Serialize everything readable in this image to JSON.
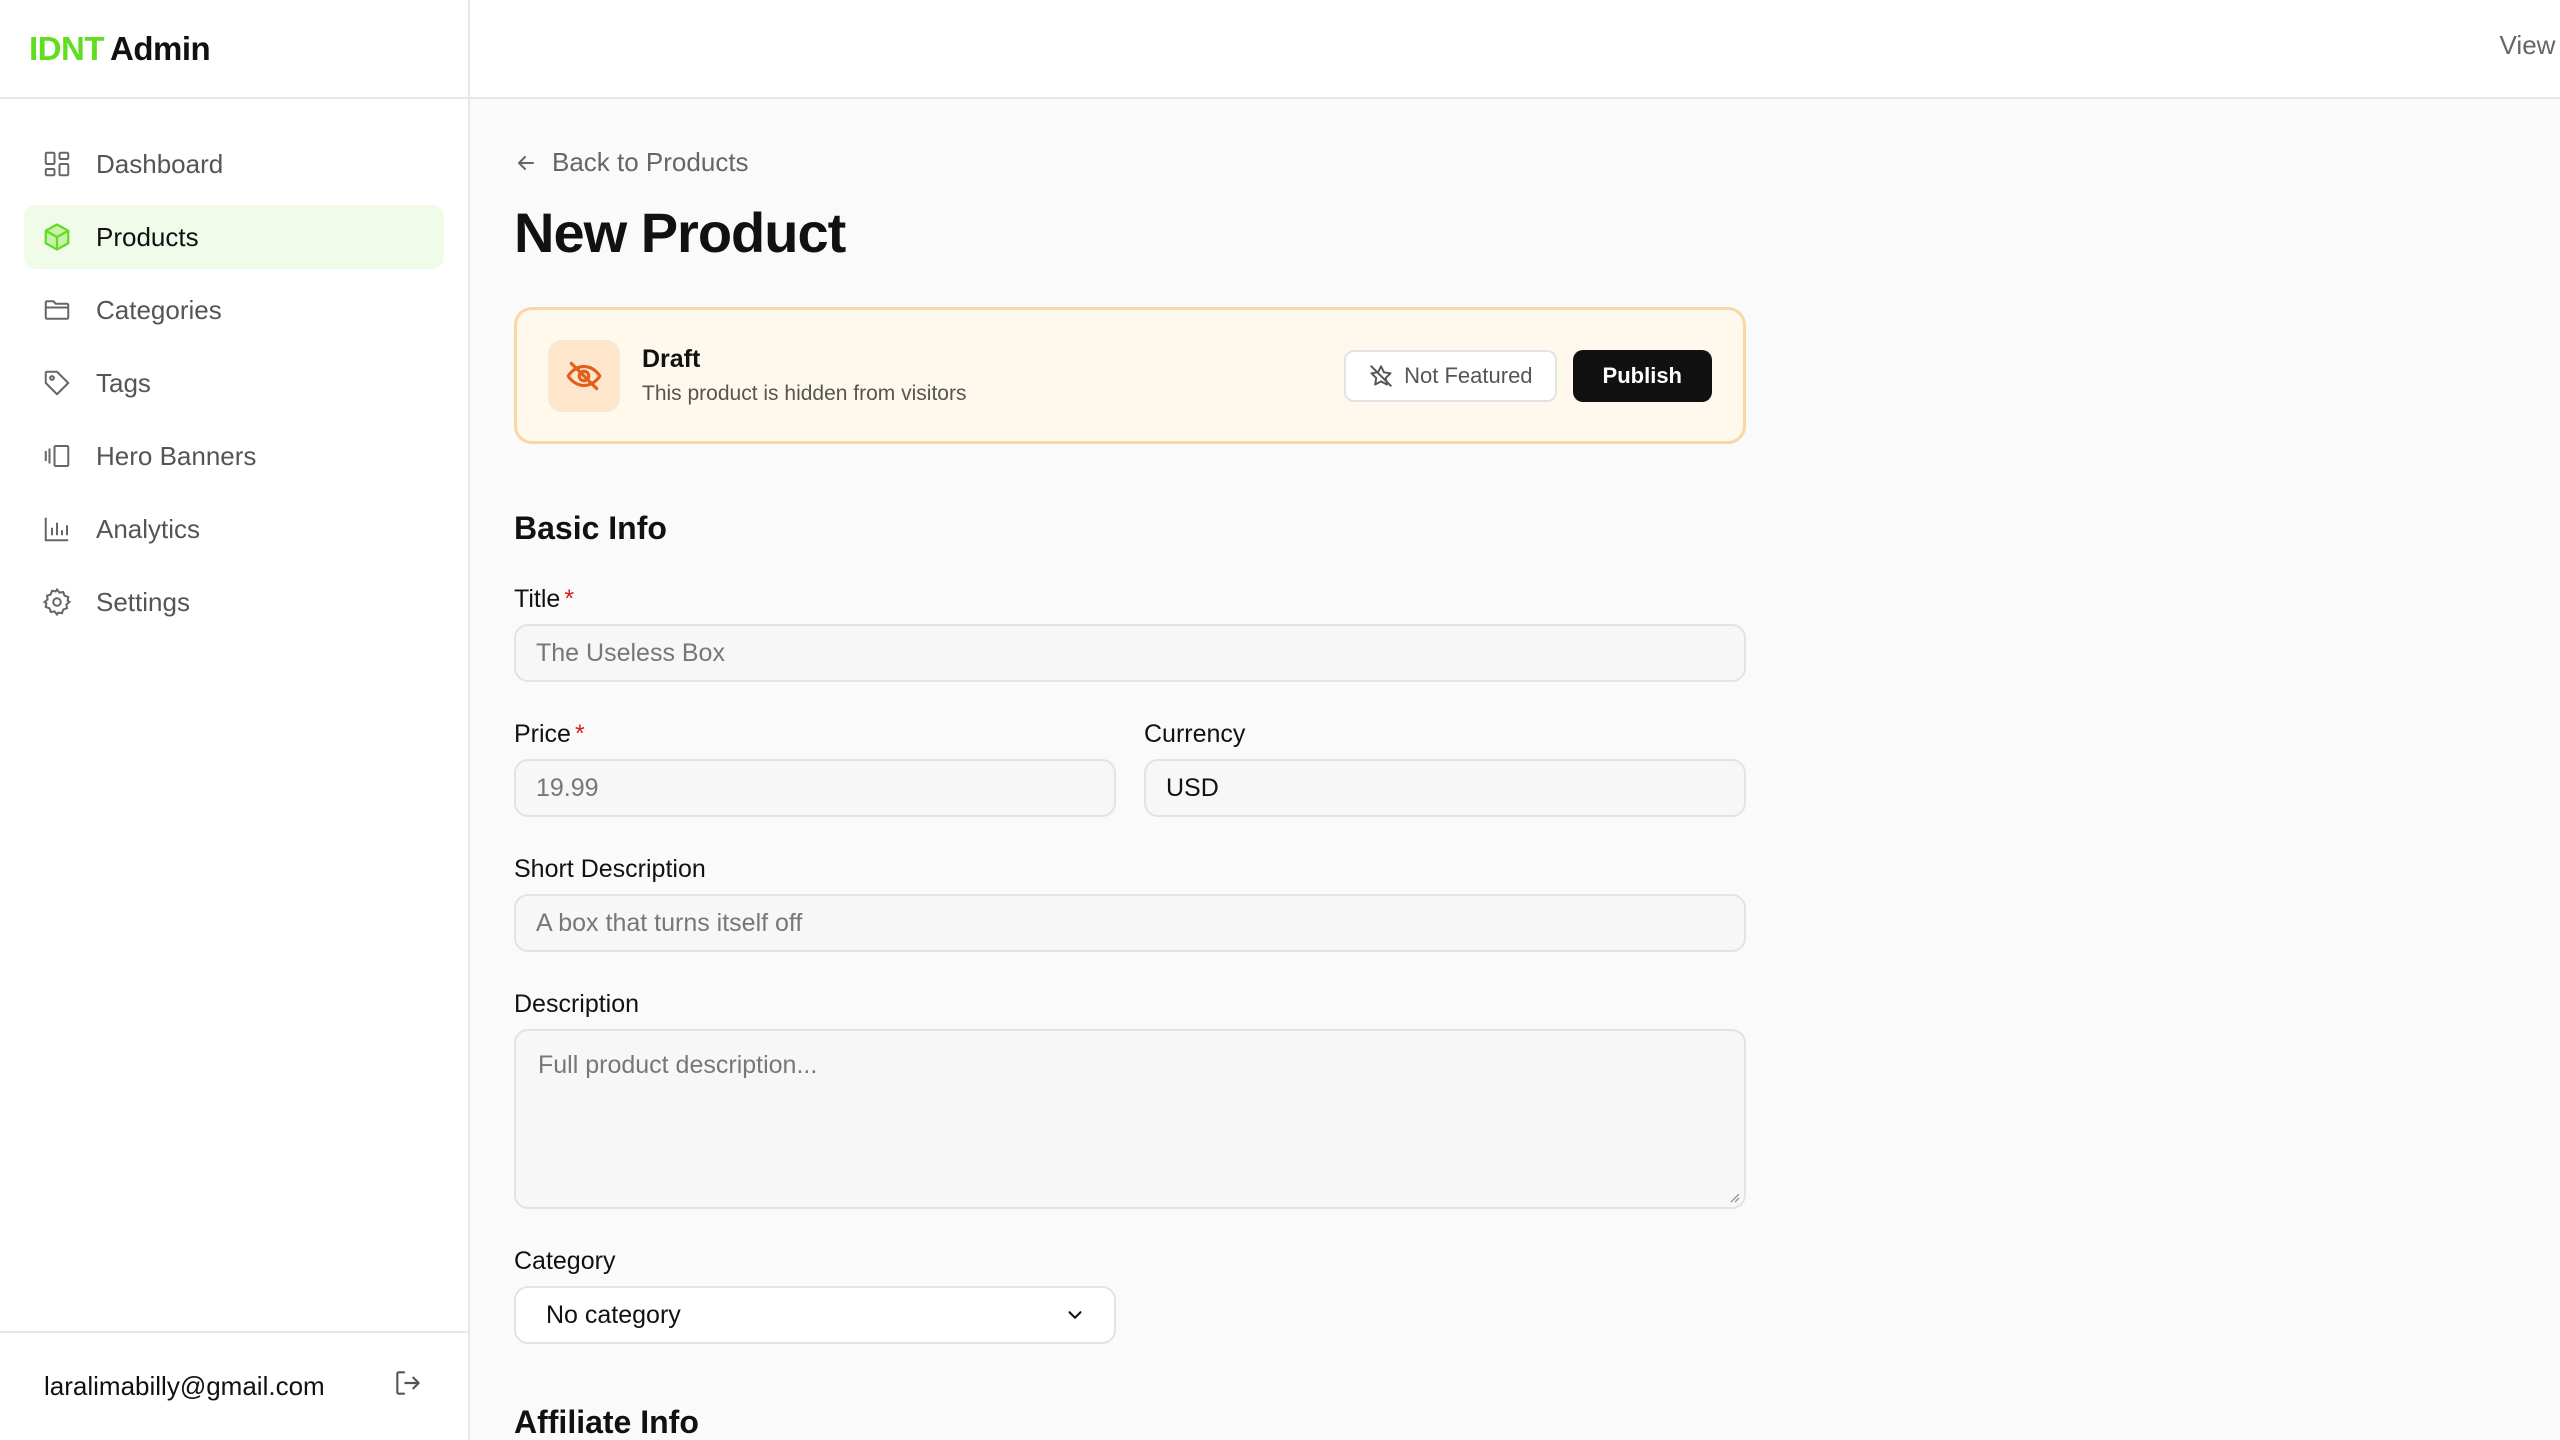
{
  "brand": {
    "accent": "IDNT",
    "rest": "Admin"
  },
  "sidebar": {
    "items": [
      {
        "label": "Dashboard",
        "icon": "grid-icon"
      },
      {
        "label": "Products",
        "icon": "box-icon",
        "active": true
      },
      {
        "label": "Categories",
        "icon": "folder-icon"
      },
      {
        "label": "Tags",
        "icon": "tag-icon"
      },
      {
        "label": "Hero Banners",
        "icon": "gallery-icon"
      },
      {
        "label": "Analytics",
        "icon": "bar-chart-icon"
      },
      {
        "label": "Settings",
        "icon": "gear-icon"
      }
    ],
    "user_email": "laralimabilly@gmail.com"
  },
  "topbar": {
    "view_link": "View S"
  },
  "main": {
    "back_label": "Back to Products",
    "page_title": "New Product",
    "status": {
      "title": "Draft",
      "subtitle": "This product is hidden from visitors",
      "featured_label": "Not Featured",
      "publish_label": "Publish"
    },
    "basic_info": {
      "section_title": "Basic Info",
      "title_label": "Title",
      "title_placeholder": "The Useless Box",
      "price_label": "Price",
      "price_placeholder": "19.99",
      "currency_label": "Currency",
      "currency_value": "USD",
      "short_desc_label": "Short Description",
      "short_desc_placeholder": "A box that turns itself off",
      "desc_label": "Description",
      "desc_placeholder": "Full product description...",
      "category_label": "Category",
      "category_value": "No category",
      "required_mark": "*"
    },
    "affiliate_title": "Affiliate Info"
  },
  "colors": {
    "brand_green": "#5ede1f",
    "active_bg": "#f0fbe9",
    "draft_bg": "#fff8ec",
    "draft_border": "#f9d7a4",
    "draft_icon": "#e0601a"
  }
}
